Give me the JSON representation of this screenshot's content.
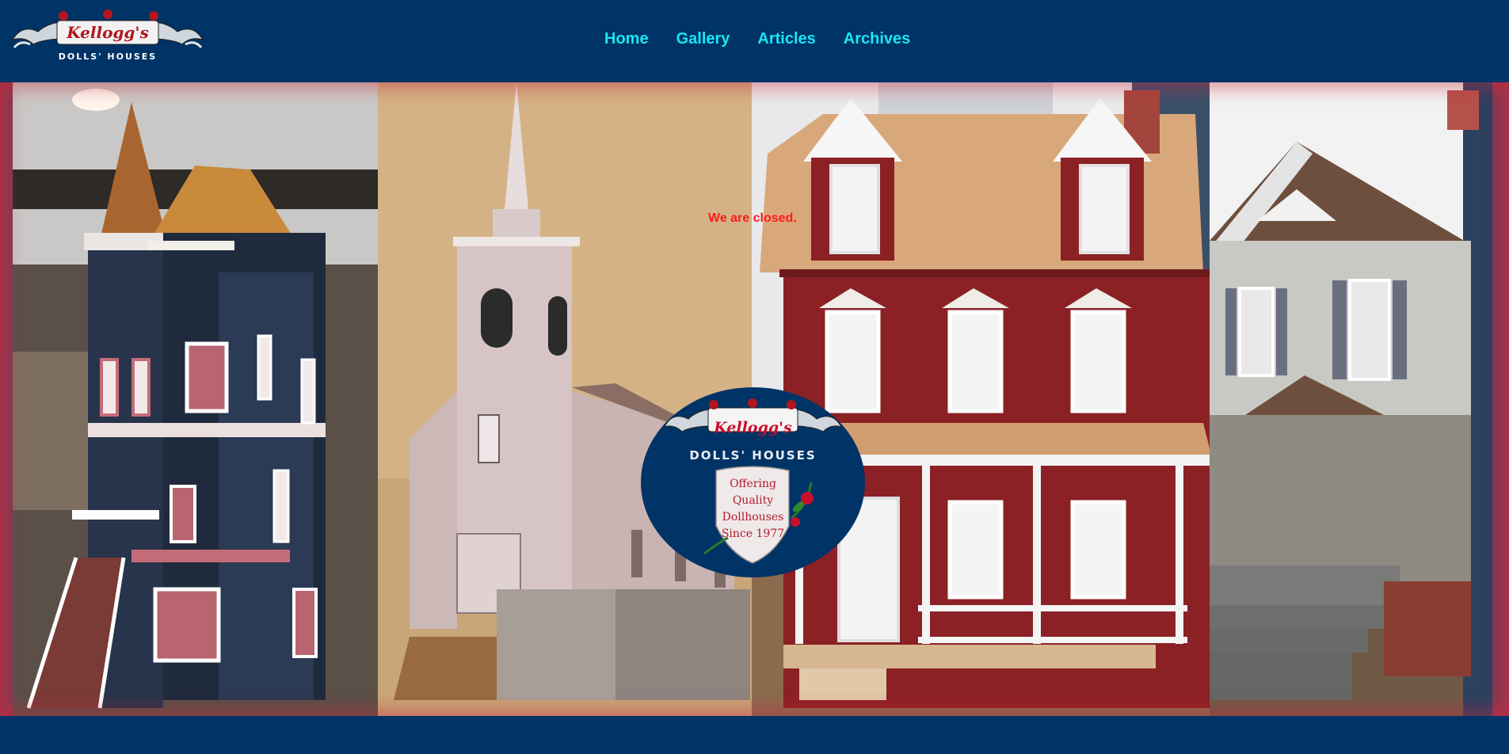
{
  "brand": {
    "name": "Kellogg's",
    "subtitle": "DOLLS' HOUSES"
  },
  "nav": {
    "items": [
      {
        "label": "Home"
      },
      {
        "label": "Gallery"
      },
      {
        "label": "Articles"
      },
      {
        "label": "Archives"
      }
    ]
  },
  "hero": {
    "notice": "We are closed.",
    "badge": {
      "name": "Kellogg's",
      "title": "DOLLS' HOUSES",
      "lines": [
        "Offering",
        "Quality",
        "Dollhouses",
        "Since 1977"
      ]
    },
    "panels": [
      "victorian-dollhouse-photo",
      "church-dollhouse-photo",
      "red-colonial-dollhouse-photo",
      "grey-cottage-dollhouse-photo"
    ]
  },
  "colors": {
    "background": "#003366",
    "nav_link": "#19e6f3",
    "notice": "#ff1a1a",
    "badge_red": "#c8102e"
  }
}
